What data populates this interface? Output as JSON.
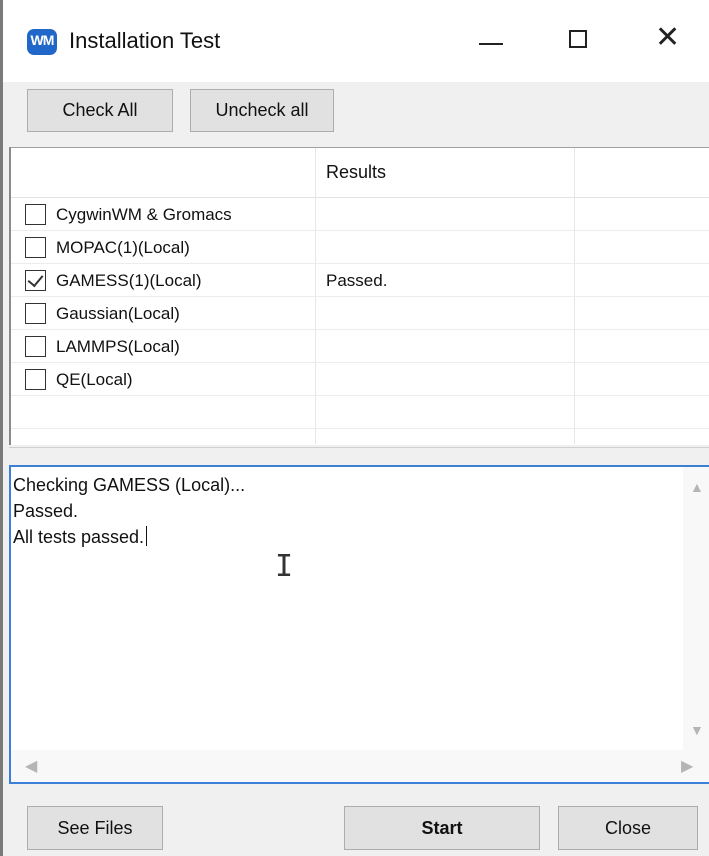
{
  "window": {
    "title": "Installation Test",
    "icon": "app-logo-icon",
    "icon_text": "WM",
    "accent": "#2067c9",
    "controls": [
      "minimize-icon",
      "maximize-icon",
      "close-icon"
    ],
    "close_glyph": "✕"
  },
  "toolbar": {
    "check_all_label": "Check All",
    "uncheck_all_label": "Uncheck all"
  },
  "list": {
    "columns": [
      "",
      "Results"
    ],
    "rows": [
      {
        "name": "CygwinWM & Gromacs",
        "checked": false,
        "result": ""
      },
      {
        "name": "MOPAC(1)(Local)",
        "checked": false,
        "result": ""
      },
      {
        "name": "GAMESS(1)(Local)",
        "checked": true,
        "result": "Passed."
      },
      {
        "name": "Gaussian(Local)",
        "checked": false,
        "result": ""
      },
      {
        "name": "LAMMPS(Local)",
        "checked": false,
        "result": ""
      },
      {
        "name": "QE(Local)",
        "checked": false,
        "result": ""
      }
    ]
  },
  "log": {
    "lines": [
      "Checking GAMESS (Local)...",
      "Passed.",
      "All tests passed."
    ],
    "border_color": "#3c7fd6"
  },
  "footer": {
    "see_files_label": "See Files",
    "start_label": "Start",
    "close_label": "Close"
  }
}
